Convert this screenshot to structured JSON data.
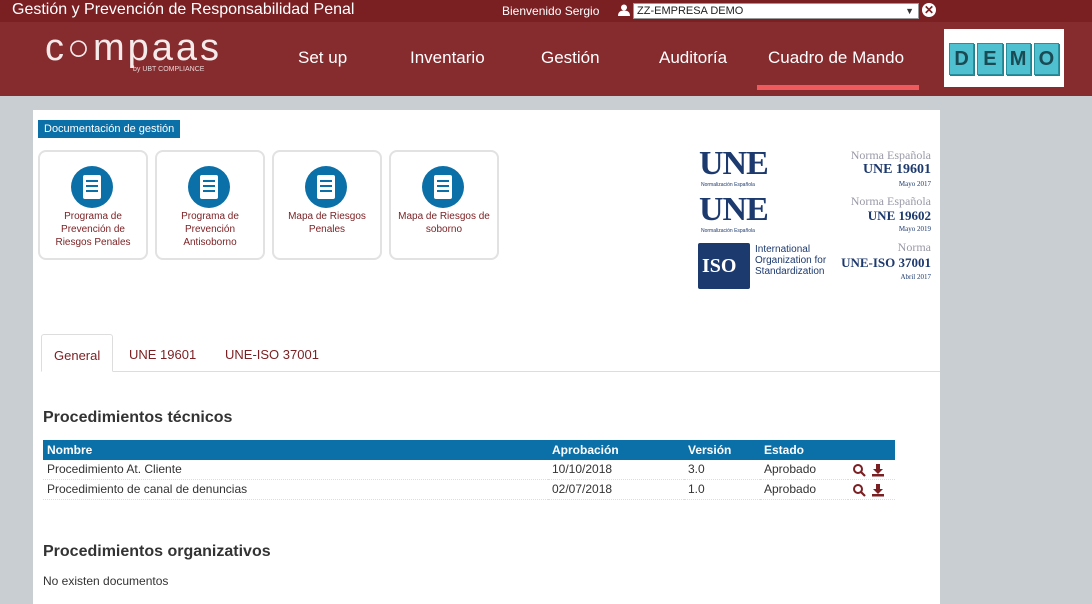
{
  "topbar": {
    "title": "Gestión y Prevención de Responsabilidad Penal",
    "welcome": "Bienvenido Sergio",
    "company": "ZZ-EMPRESA DEMO"
  },
  "nav": {
    "logo": "c○mpaas",
    "logo_sub": "by UBT COMPLIANCE",
    "items": [
      "Set up",
      "Inventario",
      "Gestión",
      "Auditoría",
      "Cuadro de Mando"
    ],
    "active": "Cuadro de Mando",
    "demo_letters": [
      "D",
      "E",
      "M",
      "O"
    ]
  },
  "docs": {
    "section_label": "Documentación de gestión",
    "tiles": [
      {
        "label": "Programa de Prevención de Riesgos Penales"
      },
      {
        "label": "Programa de Prevención Antisoborno"
      },
      {
        "label": "Mapa de Riesgos Penales"
      },
      {
        "label": "Mapa de Riesgos de soborno"
      }
    ]
  },
  "standards": {
    "une_label": "UNE",
    "une_sub": "Normalización Española",
    "s1": {
      "line1": "Norma Española",
      "line2": "UNE 19601",
      "line3": "Mayo 2017"
    },
    "s2": {
      "line1": "Norma Española",
      "line2": "UNE 19602",
      "line3": "Mayo 2019"
    },
    "s3": {
      "line1": "Norma",
      "line2": "UNE-ISO 37001",
      "line3": "Abril 2017"
    },
    "iso_label": "ISO",
    "iso_text": [
      "International",
      "Organization for",
      "Standardization"
    ]
  },
  "tabs": [
    "General",
    "UNE 19601",
    "UNE-ISO 37001"
  ],
  "active_tab": "General",
  "tecnicos": {
    "title": "Procedimientos técnicos",
    "columns": [
      "Nombre",
      "Aprobación",
      "Versión",
      "Estado"
    ],
    "rows": [
      {
        "nombre": "Procedimiento At. Cliente",
        "aprobacion": "10/10/2018",
        "version": "3.0",
        "estado": "Aprobado"
      },
      {
        "nombre": "Procedimiento de canal de denuncias",
        "aprobacion": "02/07/2018",
        "version": "1.0",
        "estado": "Aprobado"
      }
    ]
  },
  "organizativos": {
    "title": "Procedimientos organizativos",
    "empty": "No existen documentos"
  },
  "colors": {
    "brand": "#862b2e",
    "accent": "#0b6fa8",
    "active_bar": "#ef5b5d"
  }
}
